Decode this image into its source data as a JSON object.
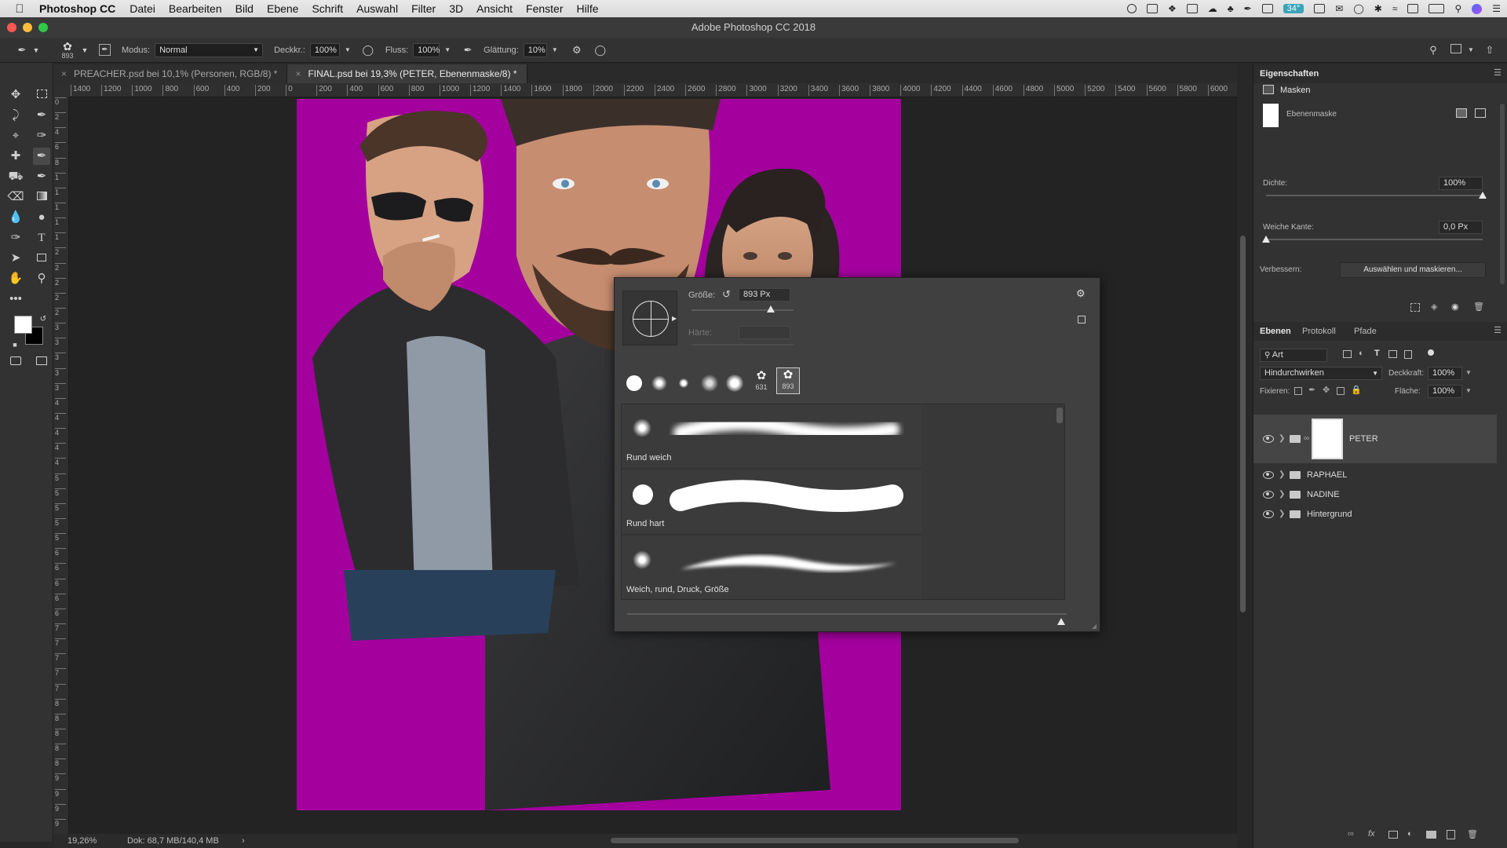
{
  "menubar": {
    "app": "Photoshop CC",
    "items": [
      "Datei",
      "Bearbeiten",
      "Bild",
      "Ebene",
      "Schrift",
      "Auswahl",
      "Filter",
      "3D",
      "Ansicht",
      "Fenster",
      "Hilfe"
    ],
    "battery": "34°"
  },
  "window": {
    "title": "Adobe Photoshop CC 2018"
  },
  "options": {
    "brush_size": "893",
    "mode_label": "Modus:",
    "mode_value": "Normal",
    "opacity_label": "Deckkr.:",
    "opacity_value": "100%",
    "flow_label": "Fluss:",
    "flow_value": "100%",
    "smoothing_label": "Glättung:",
    "smoothing_value": "10%"
  },
  "tabs": [
    {
      "label": "PREACHER.psd bei 10,1% (Personen, RGB/8) *"
    },
    {
      "label": "FINAL.psd bei 19,3% (PETER, Ebenenmaske/8) *"
    }
  ],
  "ruler_h": [
    "1400",
    "1200",
    "1000",
    "800",
    "600",
    "400",
    "200",
    "0",
    "200",
    "400",
    "600",
    "800",
    "1000",
    "1200",
    "1400",
    "1600",
    "1800",
    "2000",
    "2200",
    "2400",
    "2600",
    "2800",
    "3000",
    "3200",
    "3400",
    "3600",
    "3800",
    "4000",
    "4200",
    "4400",
    "4600",
    "4800",
    "5000",
    "5200",
    "5400",
    "5600",
    "5800",
    "6000"
  ],
  "ruler_v": [
    "0",
    "2",
    "4",
    "6",
    "8",
    "1",
    "1",
    "1",
    "1",
    "1",
    "2",
    "2",
    "2",
    "2",
    "2",
    "3",
    "3",
    "3",
    "3",
    "3",
    "4",
    "4",
    "4",
    "4",
    "4",
    "5",
    "5",
    "5",
    "5",
    "5",
    "6",
    "6",
    "6",
    "6",
    "6",
    "7",
    "7",
    "7",
    "7",
    "7",
    "8",
    "8",
    "8",
    "8",
    "8",
    "9",
    "9",
    "9",
    "9"
  ],
  "status": {
    "zoom": "19,26%",
    "doc": "Dok: 68,7 MB/140,4 MB"
  },
  "brush_popup": {
    "size_label": "Größe:",
    "size_value": "893 Px",
    "size_fraction": 0.78,
    "hardness_label": "Härte:",
    "preset_numbers": [
      "631",
      "893"
    ],
    "brushes": [
      {
        "name": "Rund weich"
      },
      {
        "name": "Rund hart"
      },
      {
        "name": "Weich, rund, Druck, Größe"
      }
    ]
  },
  "properties": {
    "title": "Eigenschaften",
    "section": "Masken",
    "mask_label": "Ebenenmaske",
    "density_label": "Dichte:",
    "density_value": "100%",
    "density_fraction": 1.0,
    "feather_label": "Weiche Kante:",
    "feather_value": "0,0 Px",
    "feather_fraction": 0.0,
    "refine_label": "Verbessern:",
    "refine_button": "Auswählen und maskieren..."
  },
  "layers": {
    "tabs": [
      "Ebenen",
      "Protokoll",
      "Pfade"
    ],
    "filter_label": "Art",
    "blend_mode": "Hindurchwirken",
    "opacity_label": "Deckkraft:",
    "opacity_value": "100%",
    "lock_label": "Fixieren:",
    "fill_label": "Fläche:",
    "fill_value": "100%",
    "items": [
      {
        "name": "PETER"
      },
      {
        "name": "RAPHAEL"
      },
      {
        "name": "NADINE"
      },
      {
        "name": "Hintergrund"
      }
    ]
  },
  "colors": {
    "canvas_bg": "#a4009e",
    "panel_bg": "#323232",
    "accent_battery": "#3aa3b8"
  }
}
